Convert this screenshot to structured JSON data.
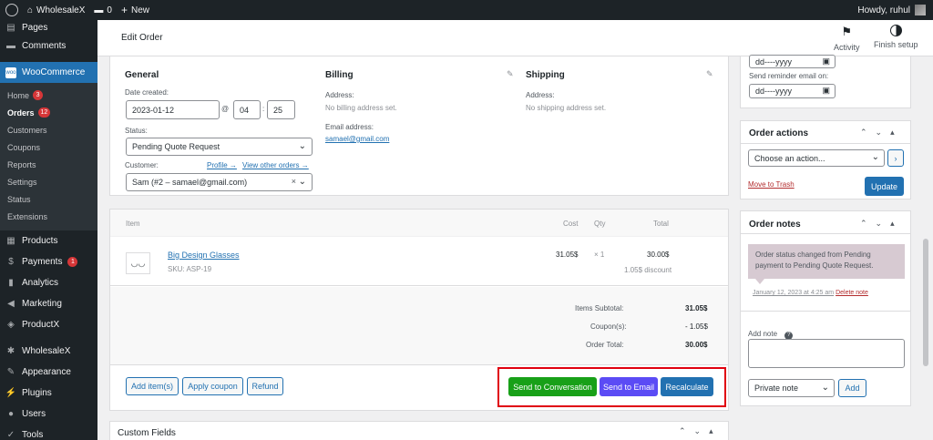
{
  "admin_bar": {
    "site_name": "WholesaleX",
    "comments_count": "0",
    "new_label": "New",
    "howdy": "Howdy, ruhul"
  },
  "sidebar": {
    "top_items": [
      {
        "label": "Pages"
      },
      {
        "label": "Comments"
      }
    ],
    "woocommerce": "WooCommerce",
    "sub_items": [
      {
        "label": "Home",
        "badge": "3"
      },
      {
        "label": "Orders",
        "badge": "12"
      },
      {
        "label": "Customers"
      },
      {
        "label": "Coupons"
      },
      {
        "label": "Reports"
      },
      {
        "label": "Settings"
      },
      {
        "label": "Status"
      },
      {
        "label": "Extensions"
      }
    ],
    "items": [
      {
        "label": "Products"
      },
      {
        "label": "Payments",
        "badge": "1"
      },
      {
        "label": "Analytics"
      },
      {
        "label": "Marketing"
      },
      {
        "label": "ProductX"
      },
      {
        "label": "WholesaleX"
      },
      {
        "label": "Appearance"
      },
      {
        "label": "Plugins"
      },
      {
        "label": "Users"
      },
      {
        "label": "Tools"
      }
    ]
  },
  "header": {
    "title": "Edit Order",
    "activity": "Activity",
    "finish_setup": "Finish setup"
  },
  "order": {
    "general": {
      "heading": "General",
      "date_label": "Date created:",
      "date": "2023-01-12",
      "at": "@",
      "hour": "04",
      "minute": "25",
      "status_label": "Status:",
      "status": "Pending Quote Request",
      "customer_label": "Customer:",
      "profile_link": "Profile →",
      "view_orders_link": "View other orders →",
      "customer": "Sam (#2 – samael@gmail.com)"
    },
    "billing": {
      "heading": "Billing",
      "address_label": "Address:",
      "address": "No billing address set.",
      "email_label": "Email address:",
      "email": "samael@gmail.com"
    },
    "shipping": {
      "heading": "Shipping",
      "address_label": "Address:",
      "address": "No shipping address set."
    }
  },
  "items_table": {
    "headers": {
      "item": "Item",
      "cost": "Cost",
      "qty": "Qty",
      "total": "Total"
    },
    "rows": [
      {
        "name": "Big Design Glasses",
        "sku": "SKU: ASP-19",
        "cost": "31.05$",
        "qty": "× 1",
        "total": "30.00$",
        "discount": "1.05$ discount"
      }
    ],
    "totals": {
      "subtotal_label": "Items Subtotal:",
      "subtotal": "31.05$",
      "coupons_label": "Coupon(s):",
      "coupons": "- 1.05$",
      "order_total_label": "Order Total:",
      "order_total": "30.00$"
    },
    "buttons": {
      "add_items": "Add item(s)",
      "apply_coupon": "Apply coupon",
      "refund": "Refund",
      "send_conversation": "Send to Conversation",
      "send_email": "Send to Email",
      "recalculate": "Recalculate"
    }
  },
  "custom_fields": {
    "heading": "Custom Fields"
  },
  "right": {
    "date_placeholder": "dd----yyyy",
    "reminder_label": "Send reminder email on:",
    "order_actions": {
      "heading": "Order actions",
      "select": "Choose an action...",
      "trash": "Move to Trash",
      "update": "Update"
    },
    "order_notes": {
      "heading": "Order notes",
      "note_text": "Order status changed from Pending payment to Pending Quote Request.",
      "note_meta": "January 12, 2023 at 4:25 am",
      "delete_note": "Delete note",
      "add_note_label": "Add note",
      "note_type": "Private note",
      "add_button": "Add"
    }
  },
  "colors": {
    "accent": "#2271b1",
    "highlight_border": "#e0000f",
    "send_conversation_bg": "#18a018",
    "send_email_bg": "#5b4bf5",
    "note_bg": "#d7cad2"
  }
}
